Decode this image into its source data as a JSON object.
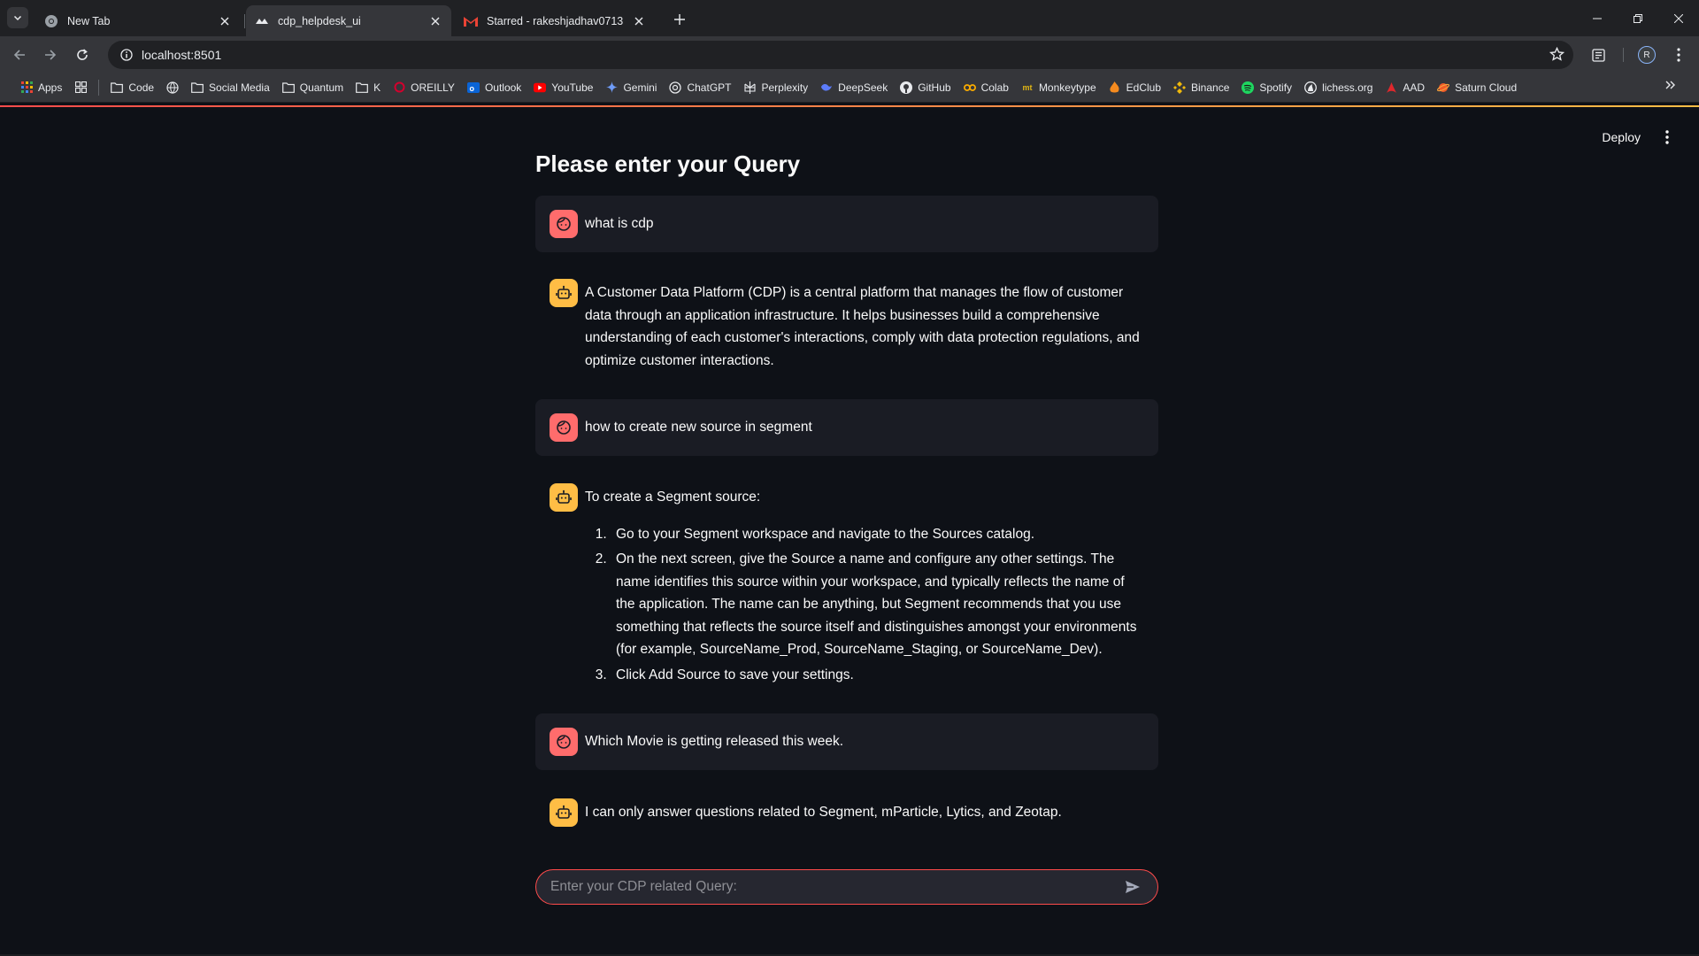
{
  "browser": {
    "tabs": [
      {
        "title": "New Tab",
        "active": false
      },
      {
        "title": "cdp_helpdesk_ui",
        "active": true
      },
      {
        "title": "Starred - rakeshjadhav0713@gmail.com",
        "active": false
      }
    ],
    "url": "localhost:8501",
    "profile_initial": "R",
    "bookmarks": [
      {
        "label": "Apps",
        "icon": "apps-grid-icon"
      },
      {
        "label": "",
        "icon": "grid-icon"
      },
      {
        "label": "Code",
        "icon": "folder-icon"
      },
      {
        "label": "",
        "icon": "globe-icon"
      },
      {
        "label": "Social Media",
        "icon": "folder-icon"
      },
      {
        "label": "Quantum",
        "icon": "folder-icon"
      },
      {
        "label": "K",
        "icon": "folder-icon"
      },
      {
        "label": "OREILLY",
        "icon": "oreilly-icon"
      },
      {
        "label": "Outlook",
        "icon": "outlook-icon"
      },
      {
        "label": "YouTube",
        "icon": "youtube-icon"
      },
      {
        "label": "Gemini",
        "icon": "gemini-icon"
      },
      {
        "label": "ChatGPT",
        "icon": "chatgpt-icon"
      },
      {
        "label": "Perplexity",
        "icon": "perplexity-icon"
      },
      {
        "label": "DeepSeek",
        "icon": "deepseek-icon"
      },
      {
        "label": "GitHub",
        "icon": "github-icon"
      },
      {
        "label": "Colab",
        "icon": "colab-icon"
      },
      {
        "label": "Monkeytype",
        "icon": "monkeytype-icon"
      },
      {
        "label": "EdClub",
        "icon": "edclub-icon"
      },
      {
        "label": "Binance",
        "icon": "binance-icon"
      },
      {
        "label": "Spotify",
        "icon": "spotify-icon"
      },
      {
        "label": "lichess.org",
        "icon": "lichess-icon"
      },
      {
        "label": "AAD",
        "icon": "pdf-icon"
      },
      {
        "label": "Saturn Cloud",
        "icon": "saturn-icon"
      }
    ]
  },
  "app": {
    "deploy_label": "Deploy",
    "page_title": "Please enter your Query",
    "messages": [
      {
        "role": "user",
        "text": "what is cdp"
      },
      {
        "role": "assistant",
        "text": "A Customer Data Platform (CDP) is a central platform that manages the flow of customer data through an application infrastructure. It helps businesses build a comprehensive understanding of each customer's interactions, comply with data protection regulations, and optimize customer interactions."
      },
      {
        "role": "user",
        "text": "how to create new source in segment"
      },
      {
        "role": "assistant",
        "text": "To create a Segment source:",
        "steps": [
          "Go to your Segment workspace and navigate to the Sources catalog.",
          "On the next screen, give the Source a name and configure any other settings. The name identifies this source within your workspace, and typically reflects the name of the application. The name can be anything, but Segment recommends that you use something that reflects the source itself and distinguishes amongst your environments (for example, SourceName_Prod, SourceName_Staging, or SourceName_Dev).",
          "Click Add Source to save your settings."
        ]
      },
      {
        "role": "user",
        "text": "Which Movie is getting released this week."
      },
      {
        "role": "assistant",
        "text": "I can only answer questions related to Segment, mParticle, Lytics, and Zeotap."
      }
    ],
    "chat_input": {
      "placeholder": "Enter your CDP related Query:",
      "value": ""
    }
  },
  "colors": {
    "background": "#0e1117",
    "user_avatar": "#ff6c6c",
    "assistant_avatar": "#ffbd45",
    "accent": "#ff4b4b"
  }
}
